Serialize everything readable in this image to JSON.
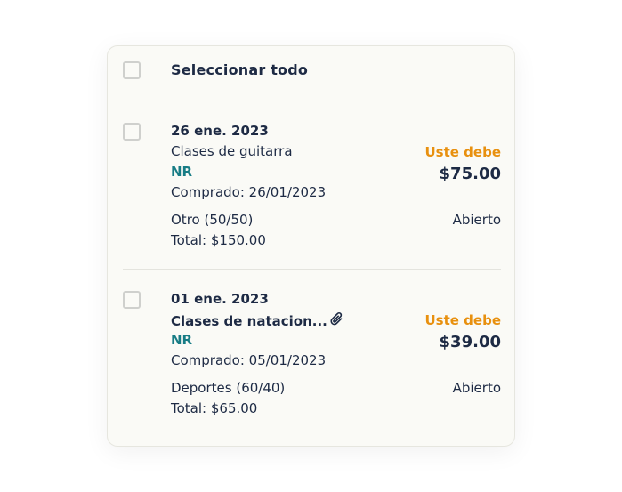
{
  "header": {
    "select_all_label": "Seleccionar todo"
  },
  "transactions": [
    {
      "date": "26 ene. 2023",
      "description": "Clases de guitarra",
      "has_attachment": false,
      "tag": "NR",
      "purchased": "Comprado: 26/01/2023",
      "category": "Otro (50/50)",
      "total": "Total: $150.00",
      "owe_label": "Uste debe",
      "amount": "$75.00",
      "status": "Abierto"
    },
    {
      "date": "01 ene. 2023",
      "description": "Clases de natacion...",
      "has_attachment": true,
      "attachment_icon": "paperclip-icon",
      "tag": "NR",
      "purchased": "Comprado: 05/01/2023",
      "category": "Deportes (60/40)",
      "total": "Total: $65.00",
      "owe_label": "Uste debe",
      "amount": "$39.00",
      "status": "Abierto"
    }
  ],
  "colors": {
    "text": "#1d2a44",
    "owe": "#e8900f",
    "tag": "#177c85",
    "card_background": "#fafaf6"
  }
}
